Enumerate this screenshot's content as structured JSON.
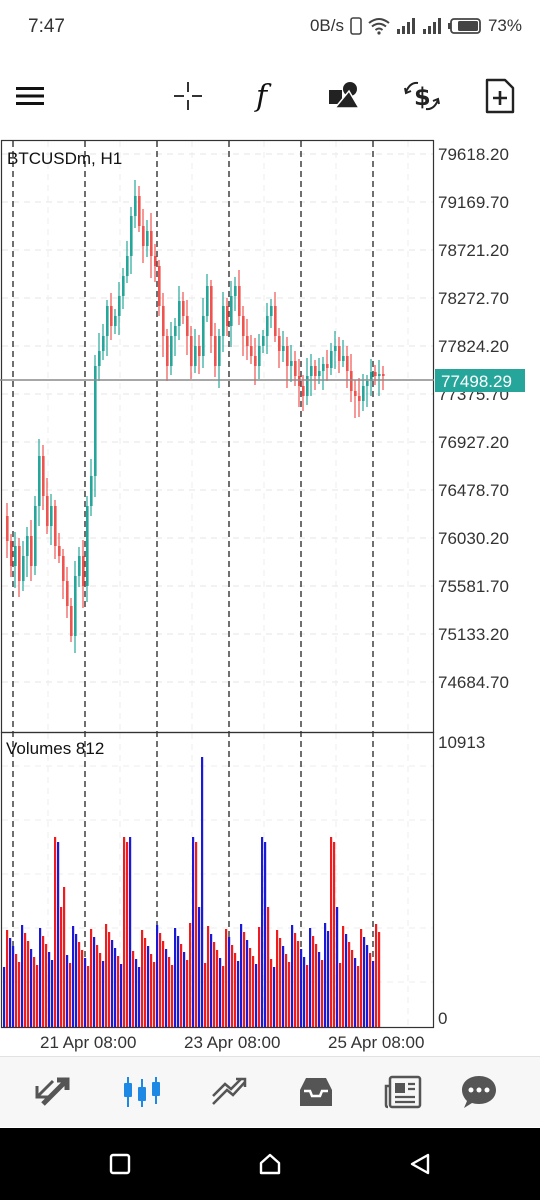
{
  "status_bar": {
    "time": "7:47",
    "net_speed": "0B/s",
    "battery": "73%"
  },
  "toolbar": {
    "icons": [
      "menu-icon",
      "crosshair-icon",
      "function-icon",
      "shapes-icon",
      "trade-icon",
      "new-order-icon"
    ]
  },
  "chart": {
    "symbol_label": "BTCUSDm, H1",
    "current_price": "77498.29",
    "price_ticks": [
      "79618.20",
      "79169.70",
      "78721.20",
      "78272.70",
      "77824.20",
      "77375.70",
      "76927.20",
      "76478.70",
      "76030.20",
      "75581.70",
      "75133.20",
      "74684.70"
    ],
    "volume_label": "Volumes 812",
    "volume_max": "10913",
    "volume_zero": "0",
    "time_labels": [
      "21 Apr 08:00",
      "23 Apr 08:00",
      "25 Apr 08:00"
    ],
    "colors": {
      "up": "#26a69a",
      "down": "#ef5350",
      "vol_up": "#1a1ad6",
      "vol_down": "#ee1c1c",
      "price_tag": "#26a69a"
    }
  },
  "chart_data": {
    "type": "candlestick",
    "title": "BTCUSDm, H1",
    "ylim": [
      74400,
      79750
    ],
    "current_price": 77498.29,
    "volume_ylim": [
      0,
      10913
    ],
    "day_separators": 6,
    "x_tick_labels": [
      "21 Apr 08:00",
      "23 Apr 08:00",
      "25 Apr 08:00"
    ]
  },
  "bottom_nav": {
    "items": [
      "quotes-icon",
      "chart-icon",
      "trade-icon",
      "history-icon",
      "news-icon",
      "messages-icon"
    ],
    "active": "chart-icon"
  },
  "system_nav": {
    "items": [
      "recents-button",
      "home-button",
      "back-button"
    ]
  }
}
